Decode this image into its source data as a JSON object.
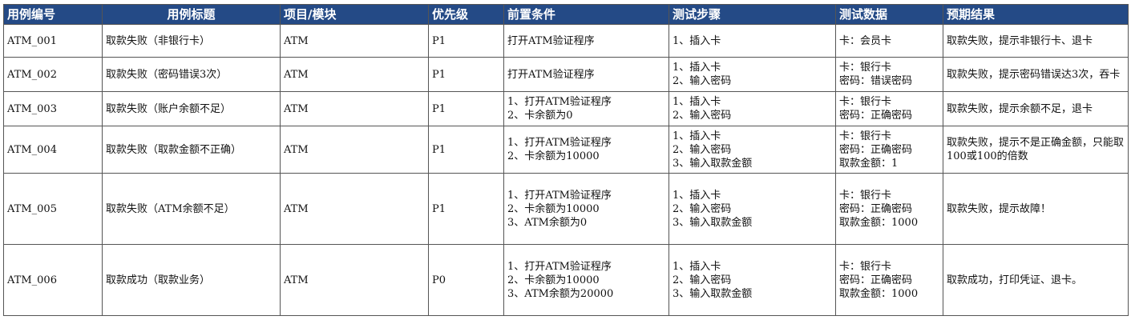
{
  "headers": [
    "用例编号",
    "用例标题",
    "项目/模块",
    "优先级",
    "前置条件",
    "测试步骤",
    "测试数据",
    "预期结果"
  ],
  "rows": [
    {
      "id": "ATM_001",
      "title": "取款失败（非银行卡）",
      "module": "ATM",
      "priority": "P1",
      "precondition": [
        "打开ATM验证程序"
      ],
      "steps": [
        "1、插入卡"
      ],
      "testdata": [
        "卡：会员卡"
      ],
      "expected": "取款失败，提示非银行卡、退卡"
    },
    {
      "id": "ATM_002",
      "title": "取款失败（密码错误3次）",
      "module": "ATM",
      "priority": "P1",
      "precondition": [
        "打开ATM验证程序"
      ],
      "steps": [
        "1、插入卡",
        "2、输入密码"
      ],
      "testdata": [
        "卡：银行卡",
        "密码：错误密码"
      ],
      "expected": "取款失败，提示密码错误达3次，吞卡"
    },
    {
      "id": "ATM_003",
      "title": "取款失败（账户余额不足）",
      "module": "ATM",
      "priority": "P1",
      "precondition": [
        "1、打开ATM验证程序",
        "2、卡余额为0"
      ],
      "steps": [
        "1、插入卡",
        "2、输入密码"
      ],
      "testdata": [
        "卡：银行卡",
        "密码：正确密码"
      ],
      "expected": "取款失败，提示余额不足，退卡"
    },
    {
      "id": "ATM_004",
      "title": "取款失败（取款金额不正确）",
      "module": "ATM",
      "priority": "P1",
      "precondition": [
        "1、打开ATM验证程序",
        "2、卡余额为10000"
      ],
      "steps": [
        "1、插入卡",
        "2、输入密码",
        "3、输入取款金额"
      ],
      "testdata": [
        "卡：银行卡",
        "密码：正确密码",
        "取款金额：1"
      ],
      "expected": "取款失败，提示不是正确金额，只能取100或100的倍数"
    },
    {
      "id": "ATM_005",
      "title": "取款失败（ATM余额不足）",
      "module": "ATM",
      "priority": "P1",
      "precondition": [
        "1、打开ATM验证程序",
        "2、卡余额为10000",
        "3、ATM余额为0"
      ],
      "steps": [
        "1、插入卡",
        "2、输入密码",
        "3、输入取款金额"
      ],
      "testdata": [
        "卡：银行卡",
        "密码：正确密码",
        "取款金额：1000"
      ],
      "expected": "取款失败，提示故障！"
    },
    {
      "id": "ATM_006",
      "title": "取款成功（取款业务）",
      "module": "ATM",
      "priority": "P0",
      "precondition": [
        "1、打开ATM验证程序",
        "2、卡余额为10000",
        "3、ATM余额为20000"
      ],
      "steps": [
        "1、插入卡",
        "2、输入密码",
        "3、输入取款金额"
      ],
      "testdata": [
        "卡：银行卡",
        "密码：正确密码",
        "取款金额：1000"
      ],
      "expected": "取款成功，打印凭证、退卡。"
    }
  ]
}
